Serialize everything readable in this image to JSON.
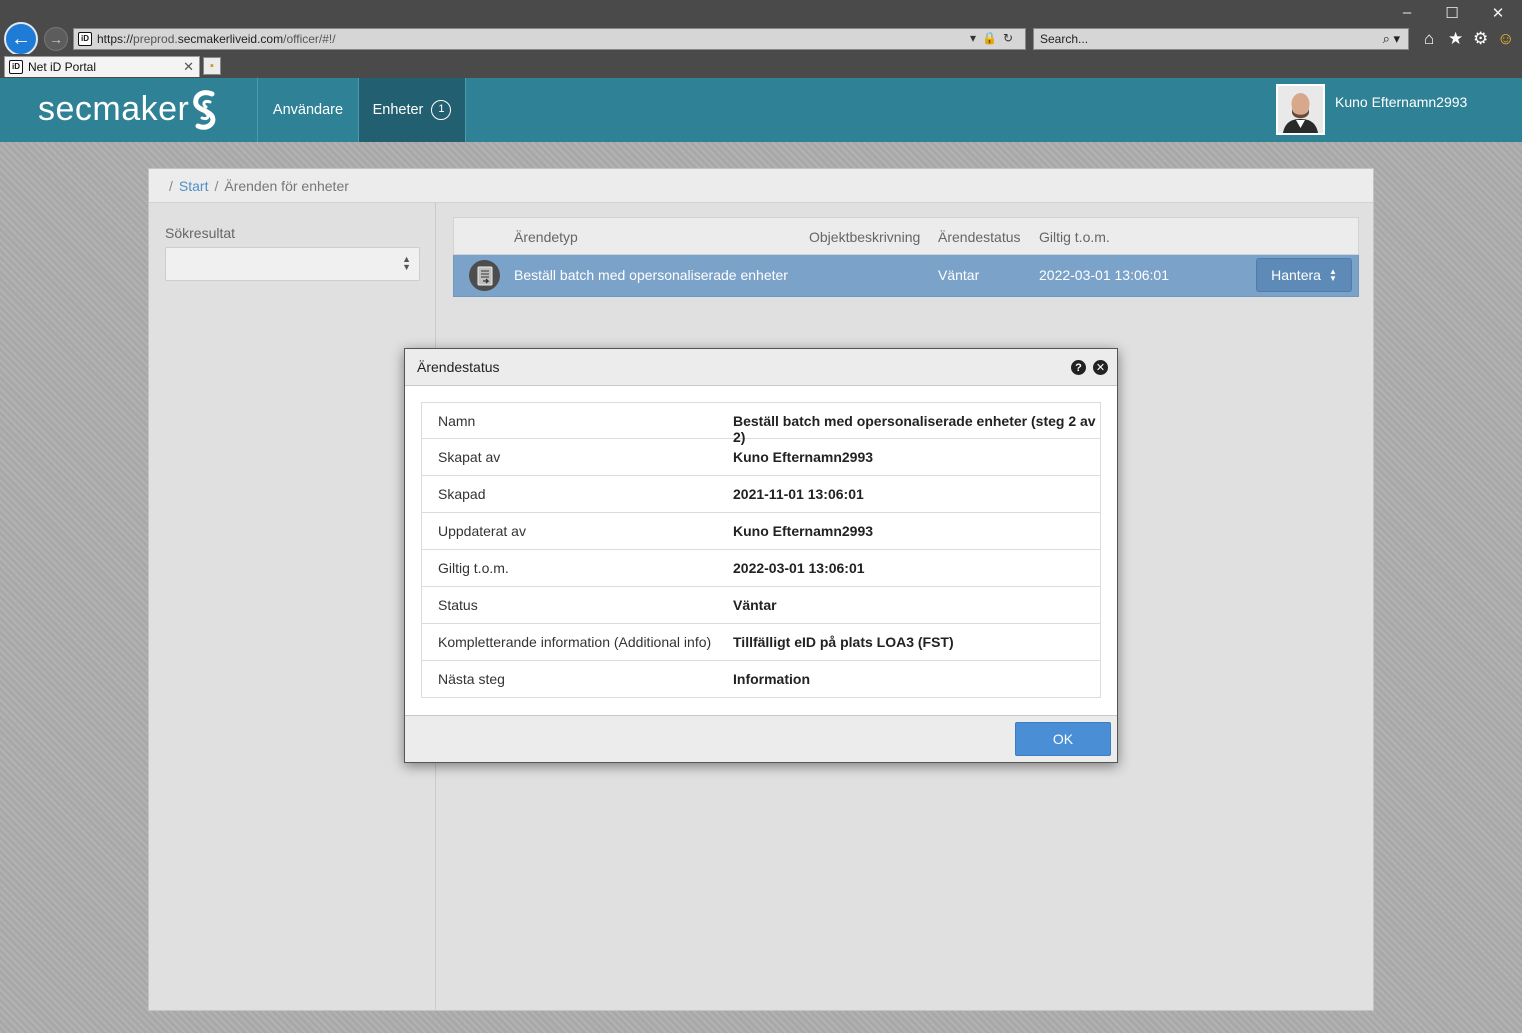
{
  "browser": {
    "url_scheme": "https://",
    "url_host_prefix": "preprod.",
    "url_domain": "secmakerliveid.com",
    "url_path": "/officer/#!/",
    "search_placeholder": "Search...",
    "tab_title": "Net iD Portal",
    "favicon_text": "iD"
  },
  "app": {
    "brand": "secmaker",
    "nav": {
      "users_label": "Användare",
      "devices_label": "Enheter",
      "devices_badge": "1"
    },
    "user_name": "Kuno Efternamn2993",
    "accent_color": "#2f8196"
  },
  "breadcrumb": {
    "start": "Start",
    "current": "Ärenden för enheter"
  },
  "sidebar": {
    "search_results_label": "Sökresultat",
    "search_results_value": ""
  },
  "cases_table": {
    "columns": [
      "Ärendetyp",
      "Objektbeskrivning",
      "Ärendestatus",
      "Giltig t.o.m."
    ],
    "rows": [
      {
        "type": "Beställ batch med opersonaliserade enheter",
        "object_description": "",
        "status": "Väntar",
        "valid_until": "2022-03-01 13:06:01",
        "action_label": "Hantera"
      }
    ]
  },
  "modal": {
    "title": "Ärendestatus",
    "rows": [
      {
        "key": "Namn",
        "value": "Beställ batch med opersonaliserade enheter (steg 2 av 2)"
      },
      {
        "key": "Skapat av",
        "value": "Kuno Efternamn2993"
      },
      {
        "key": "Skapad",
        "value": "2021-11-01 13:06:01"
      },
      {
        "key": "Uppdaterat av",
        "value": "Kuno Efternamn2993"
      },
      {
        "key": "Giltig t.o.m.",
        "value": "2022-03-01 13:06:01"
      },
      {
        "key": "Status",
        "value": "Väntar"
      },
      {
        "key": "Kompletterande information (Additional info)",
        "value": "Tillfälligt eID på plats LOA3 (FST)"
      },
      {
        "key": "Nästa steg",
        "value": "Information"
      }
    ],
    "ok_label": "OK",
    "help_icon": "?",
    "close_icon": "✕"
  },
  "window_controls": {
    "minimize": "–",
    "maximize": "☐",
    "close": "✕"
  }
}
